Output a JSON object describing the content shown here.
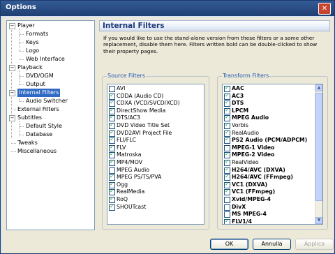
{
  "window": {
    "title": "Options",
    "close_glyph": "✕"
  },
  "tree": {
    "items": [
      {
        "label": "Player",
        "toggle": "−"
      },
      {
        "label": "Formats"
      },
      {
        "label": "Keys"
      },
      {
        "label": "Logo"
      },
      {
        "label": "Web Interface"
      },
      {
        "label": "Playback",
        "toggle": "−"
      },
      {
        "label": "DVD/OGM"
      },
      {
        "label": "Output"
      },
      {
        "label": "Internal Filters",
        "toggle": "−",
        "selected": true
      },
      {
        "label": "Audio Switcher"
      },
      {
        "label": "External Filters"
      },
      {
        "label": "Subtitles",
        "toggle": "−"
      },
      {
        "label": "Default Style"
      },
      {
        "label": "Database"
      },
      {
        "label": "Tweaks"
      },
      {
        "label": "Miscellaneous"
      }
    ]
  },
  "panel": {
    "title": "Internal Filters",
    "description": "If you would like to use the stand-alone version from these filters or a some other replacement, disable them here. Filters written bold can be double-clicked to show their property pages."
  },
  "source": {
    "label": "Source Filters",
    "items": [
      {
        "label": "AVI",
        "checked": false
      },
      {
        "label": "CDDA (Audio CD)",
        "checked": true
      },
      {
        "label": "CDXA (VCD/SVCD/XCD)",
        "checked": true
      },
      {
        "label": "DirectShow Media",
        "checked": true
      },
      {
        "label": "DTS/AC3",
        "checked": true
      },
      {
        "label": "DVD Video Title Set",
        "checked": true
      },
      {
        "label": "DVD2AVI Project File",
        "checked": true
      },
      {
        "label": "FLI/FLC",
        "checked": true
      },
      {
        "label": "FLV",
        "checked": true
      },
      {
        "label": "Matroska",
        "checked": true
      },
      {
        "label": "MP4/MOV",
        "checked": true
      },
      {
        "label": "MPEG Audio",
        "checked": false
      },
      {
        "label": "MPEG PS/TS/PVA",
        "checked": true
      },
      {
        "label": "Ogg",
        "checked": true
      },
      {
        "label": "RealMedia",
        "checked": true
      },
      {
        "label": "RoQ",
        "checked": true
      },
      {
        "label": "SHOUTcast",
        "checked": true
      }
    ]
  },
  "transform": {
    "label": "Transform Filters",
    "items": [
      {
        "label": "AAC",
        "checked": true,
        "bold": true
      },
      {
        "label": "AC3",
        "checked": true,
        "bold": true
      },
      {
        "label": "DTS",
        "checked": true,
        "bold": true
      },
      {
        "label": "LPCM",
        "checked": true,
        "bold": true
      },
      {
        "label": "MPEG Audio",
        "checked": true,
        "bold": true
      },
      {
        "label": "Vorbis",
        "checked": true,
        "bold": false
      },
      {
        "label": "RealAudio",
        "checked": true,
        "bold": false
      },
      {
        "label": "PS2 Audio (PCM/ADPCM)",
        "checked": true,
        "bold": true
      },
      {
        "label": "MPEG-1 Video",
        "checked": false,
        "bold": true
      },
      {
        "label": "MPEG-2 Video",
        "checked": true,
        "bold": true
      },
      {
        "label": "RealVideo",
        "checked": true,
        "bold": false
      },
      {
        "label": "H264/AVC (DXVA)",
        "checked": true,
        "bold": true
      },
      {
        "label": "H264/AVC (FFmpeg)",
        "checked": true,
        "bold": true
      },
      {
        "label": "VC1 (DXVA)",
        "checked": true,
        "bold": true
      },
      {
        "label": "VC1 (FFmpeg)",
        "checked": true,
        "bold": true
      },
      {
        "label": "Xvid/MPEG-4",
        "checked": false,
        "bold": true
      },
      {
        "label": "DivX",
        "checked": false,
        "bold": true
      },
      {
        "label": "MS MPEG-4",
        "checked": false,
        "bold": true
      },
      {
        "label": "FLV1/4",
        "checked": true,
        "bold": true
      }
    ]
  },
  "buttons": {
    "ok": "OK",
    "cancel": "Annulla",
    "apply": "Applica"
  }
}
